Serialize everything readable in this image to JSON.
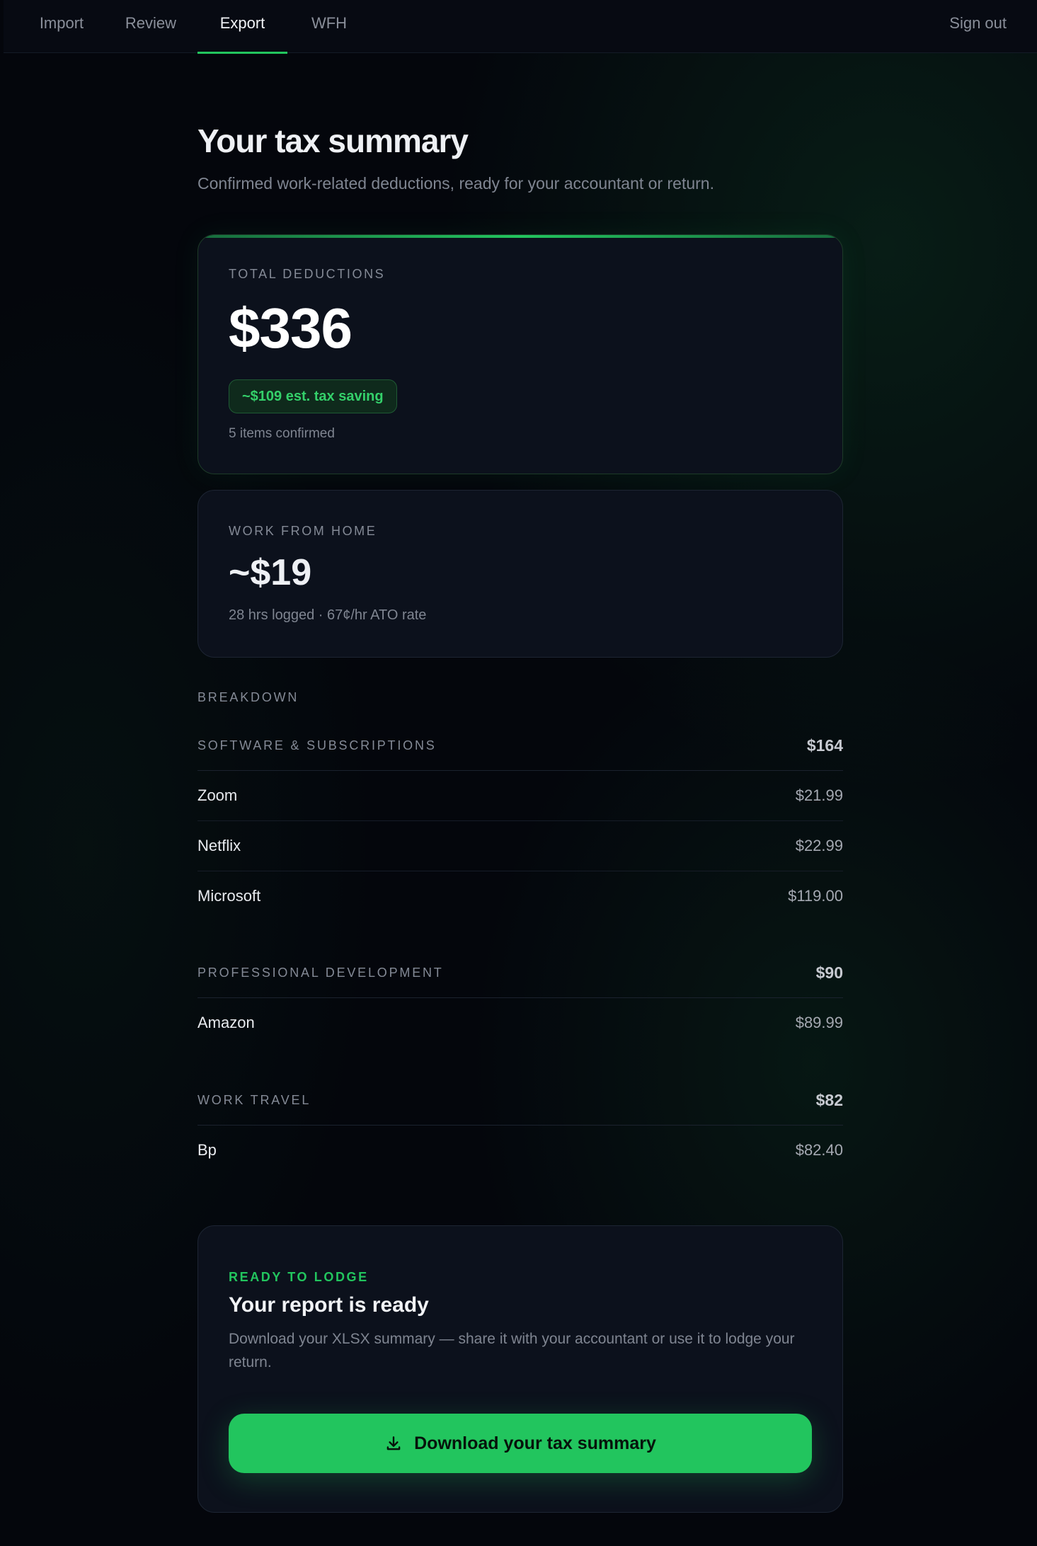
{
  "nav": {
    "tabs": [
      {
        "label": "Import"
      },
      {
        "label": "Review"
      },
      {
        "label": "Export"
      },
      {
        "label": "WFH"
      }
    ],
    "active_tab": "Export",
    "sign_out": "Sign out"
  },
  "header": {
    "title": "Your tax summary",
    "subtitle": "Confirmed work-related deductions, ready for your accountant or return."
  },
  "total_card": {
    "eyebrow": "TOTAL DEDUCTIONS",
    "amount": "$336",
    "saving_badge": "~$109 est. tax saving",
    "items_confirmed": "5 items confirmed"
  },
  "wfh_card": {
    "eyebrow": "WORK FROM HOME",
    "amount": "~$19",
    "detail": "28 hrs logged · 67¢/hr ATO rate"
  },
  "breakdown": {
    "label": "BREAKDOWN",
    "groups": [
      {
        "name": "SOFTWARE & SUBSCRIPTIONS",
        "total": "$164",
        "items": [
          {
            "name": "Zoom",
            "amount": "$21.99"
          },
          {
            "name": "Netflix",
            "amount": "$22.99"
          },
          {
            "name": "Microsoft",
            "amount": "$119.00"
          }
        ]
      },
      {
        "name": "PROFESSIONAL DEVELOPMENT",
        "total": "$90",
        "items": [
          {
            "name": "Amazon",
            "amount": "$89.99"
          }
        ]
      },
      {
        "name": "WORK TRAVEL",
        "total": "$82",
        "items": [
          {
            "name": "Bp",
            "amount": "$82.40"
          }
        ]
      }
    ]
  },
  "ready_card": {
    "eyebrow": "READY TO LODGE",
    "title": "Your report is ready",
    "description": "Download your XLSX summary — share it with your accountant or use it to lodge your return.",
    "button_label": "Download your tax summary",
    "button_icon": "download-icon"
  },
  "colors": {
    "accent": "#22c55e",
    "background": "#04060c",
    "card": "#0c111c"
  }
}
